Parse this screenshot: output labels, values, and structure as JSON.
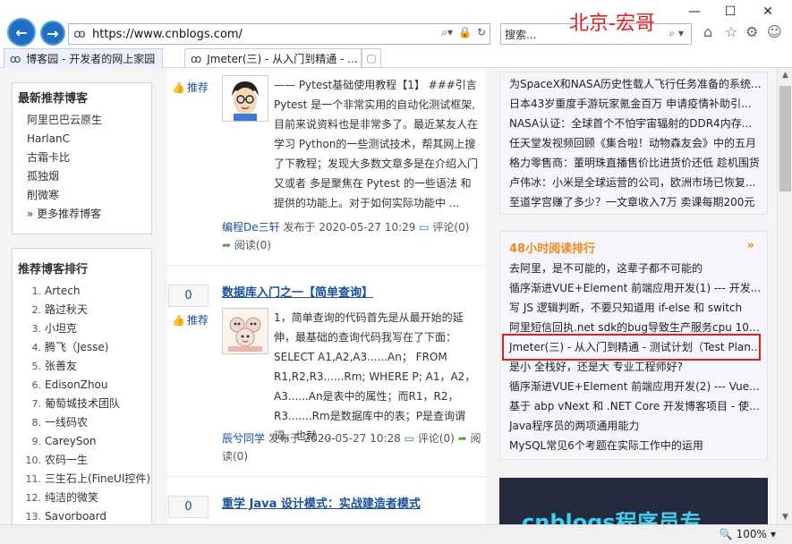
{
  "browser": {
    "url": "https://www.cnblogs.com/",
    "search_placeholder": "搜索...",
    "watermark": "北京-宏哥",
    "tabs": [
      {
        "title": "博客园 - 开发者的网上家园"
      },
      {
        "title": "Jmeter(三) - 从入门到精通 - ..."
      }
    ],
    "zoom": "100%"
  },
  "sidebar": {
    "recommended": {
      "title": "最新推荐博客",
      "items": [
        "阿里巴巴云原生",
        "HarlanC",
        "古霜卡比",
        "孤独烟",
        "削微寒"
      ],
      "more": "» 更多推荐博客"
    },
    "ranking": {
      "title": "推荐博客排行",
      "items": [
        {
          "num": "1.",
          "name": "Artech"
        },
        {
          "num": "2.",
          "name": "路过秋天"
        },
        {
          "num": "3.",
          "name": "小坦克"
        },
        {
          "num": "4.",
          "name": "腾飞（Jesse)"
        },
        {
          "num": "5.",
          "name": "张善友"
        },
        {
          "num": "6.",
          "name": "EdisonZhou"
        },
        {
          "num": "7.",
          "name": "葡萄城技术团队"
        },
        {
          "num": "8.",
          "name": "一线码农"
        },
        {
          "num": "9.",
          "name": "CareySon"
        },
        {
          "num": "10.",
          "name": "农码一生"
        },
        {
          "num": "11.",
          "name": "三生石上(FineUI控件)"
        },
        {
          "num": "12.",
          "name": "纯洁的微笑"
        },
        {
          "num": "13.",
          "name": "Savorboard"
        }
      ]
    }
  },
  "posts": [
    {
      "recommend_label": "推荐",
      "summary": "—— Pytest基础使用教程【1】 ###引言 Pytest 是一个非常实用的自动化测试框架, 目前来说资料也是非常多了。最近某友人在学习 Python的一些测试技术，帮其网上搜了下教程；发现大多数文章多是在介绍入门 又或者 多是聚焦在 Pytest 的一些语法 和 提供的功能上。对于如何实际功能中 ...",
      "author": "编程De三轩",
      "published": "发布于 2020-05-27 10:29",
      "comments": "评论(0)",
      "reads": "阅读(0)"
    },
    {
      "votes": "0",
      "recommend_label": "推荐",
      "title": "数据库入门之一【简单查询】",
      "summary": "1，简单查询的代码首先是从最开始的延伸，最基础的查询代码我写在了下面： SELECT A1,A2,A3......An； FROM R1,R2,R3......Rm; WHERE P; A1，A2，A3......An是表中的属性；而R1，R2，R3.......Rm是数据库中的表；P是查询谓词，也就 ...",
      "author": "辰兮同学",
      "published": "发布于 2020-05-27 10:28",
      "comments": "评论(0)",
      "reads": "阅读(0)"
    },
    {
      "votes": "0",
      "title": "重学 Java 设计模式：实战建造者模式"
    }
  ],
  "news": [
    "为SpaceX和NASA历史性载人飞行任务准备的系统...",
    "日本43岁重度手游玩家氪金百万 申请疫情补助引...",
    "NASA认证：全球首个不怕宇宙辐射的DDR4内存...",
    "任天堂发视频回顾《集合啦！动物森友会》中的五月",
    "格力零售商：董明珠直播售价比进货价还低 趁机围货",
    "卢伟冰：小米是全球运营的公司，欧洲市场已恢复...",
    "至道学宫赚了多少？一文章收入7万 卖课每期200元"
  ],
  "reading_rank": {
    "title": "48小时阅读排行",
    "more": "»",
    "items": [
      "去阿里，是不可能的，这辈子都不可能的",
      "循序渐进VUE+Element 前端应用开发(1) --- 开发...",
      "写 JS 逻辑判断，不要只知道用 if-else 和 switch",
      "阿里短信回执.net sdk的bug导致生产服务cpu 100...",
      "Jmeter(三) - 从入门到精通 - 测试计划（Test Plan...",
      "是小 全栈好，还是大 专业工程师好?",
      "循序渐进VUE+Element 前端应用开发(2) --- Vuex...",
      "基于 abp vNext 和 .NET Core 开发博客项目 - 使用...",
      "Java程序员的两项通用能力",
      "MySQL常见6个考题在实际工作中的运用"
    ]
  },
  "banner": {
    "text": "cnblogs程序员专"
  }
}
